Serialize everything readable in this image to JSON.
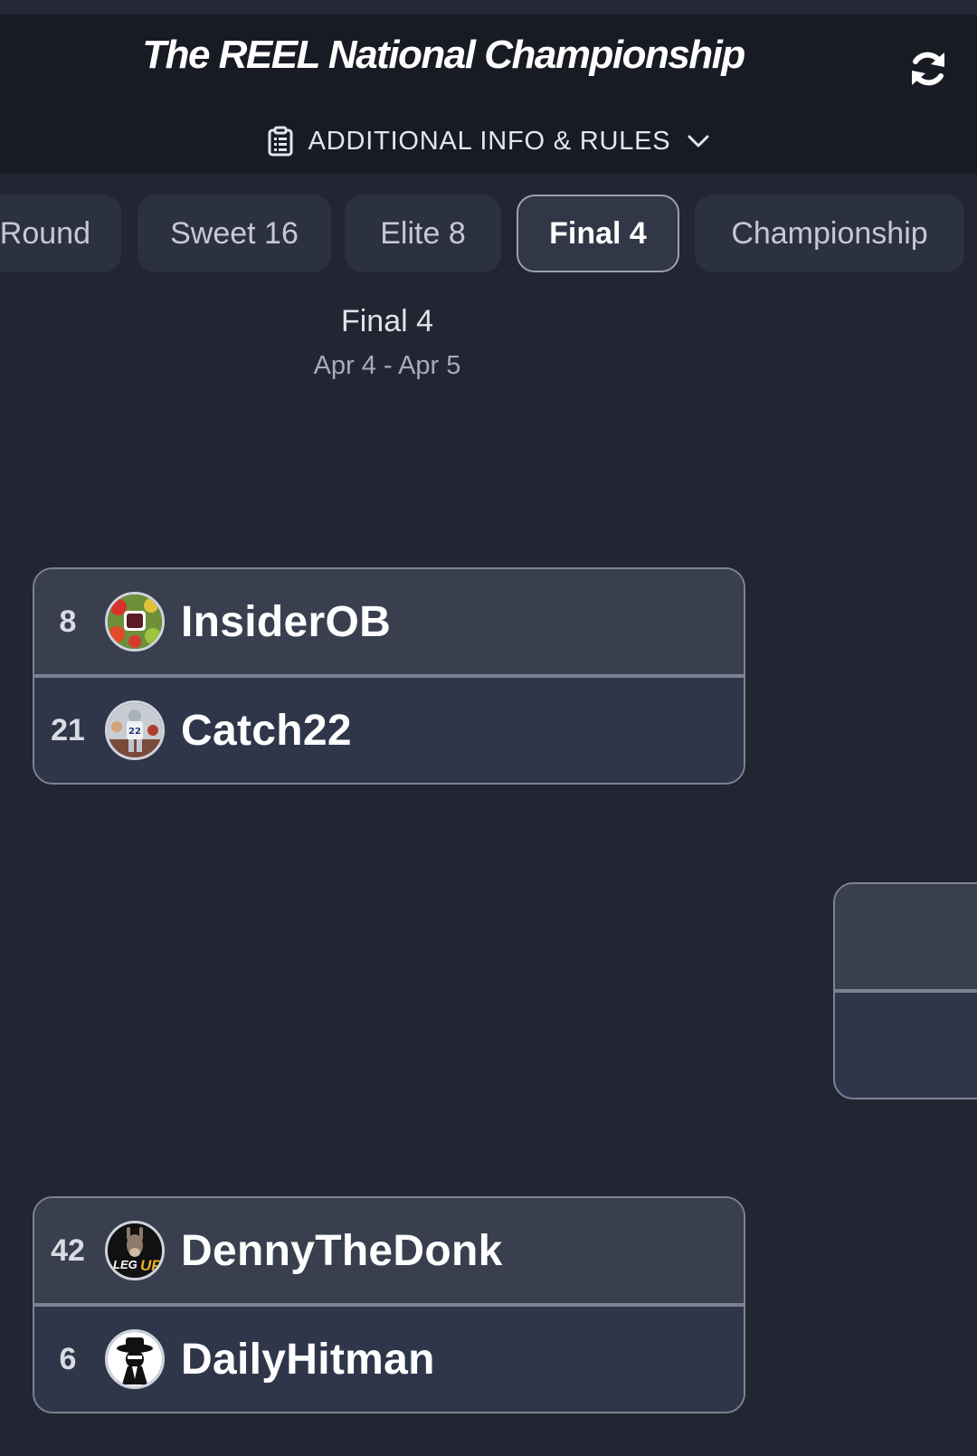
{
  "header": {
    "title": "The REEL National Championship",
    "info_label": "ADDITIONAL INFO & RULES",
    "icons": [
      "refresh-icon",
      "clipboard-icon",
      "chevron-down-icon"
    ]
  },
  "tabs": [
    {
      "label": "Round"
    },
    {
      "label": "Sweet 16"
    },
    {
      "label": "Elite 8"
    },
    {
      "label": "Final 4",
      "active": true
    },
    {
      "label": "Championship"
    }
  ],
  "round": {
    "title": "Final 4",
    "dates": "Apr 4 - Apr 5"
  },
  "matchups": [
    {
      "top": {
        "seed": "8",
        "name": "InsiderOB"
      },
      "bottom": {
        "seed": "21",
        "name": "Catch22"
      }
    },
    {
      "top": {
        "seed": "42",
        "name": "DennyTheDonk"
      },
      "bottom": {
        "seed": "6",
        "name": "DailyHitman"
      }
    }
  ],
  "colors": {
    "background": "#222632",
    "header": "#181b24",
    "card": "#343a4a",
    "border": "#7c8292"
  }
}
